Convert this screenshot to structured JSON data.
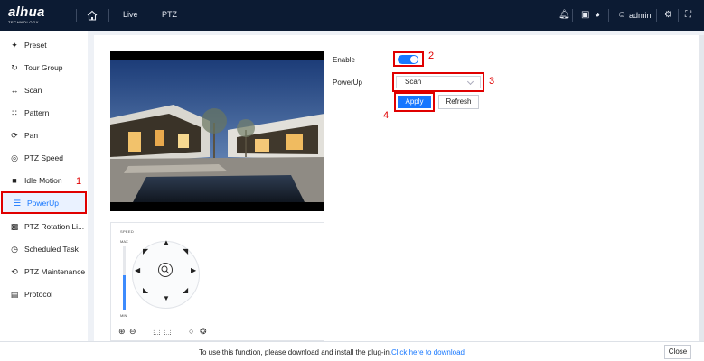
{
  "header": {
    "logo_main": "alhua",
    "logo_sub": "TECHNOLOGY",
    "tabs": [
      {
        "label": "Live"
      },
      {
        "label": "PTZ"
      }
    ],
    "user": "admin",
    "icons": [
      "home-icon",
      "bell-icon",
      "shirt-icon",
      "help-icon",
      "user-icon",
      "settings-icon",
      "fullscreen-icon"
    ]
  },
  "sidebar": {
    "items": [
      {
        "label": "Preset",
        "icon": "preset-icon"
      },
      {
        "label": "Tour Group",
        "icon": "tour-group-icon"
      },
      {
        "label": "Scan",
        "icon": "scan-icon"
      },
      {
        "label": "Pattern",
        "icon": "pattern-icon"
      },
      {
        "label": "Pan",
        "icon": "pan-icon"
      },
      {
        "label": "PTZ Speed",
        "icon": "speed-icon"
      },
      {
        "label": "Idle Motion",
        "icon": "idle-motion-icon"
      },
      {
        "label": "PowerUp",
        "icon": "powerup-icon",
        "active": true
      },
      {
        "label": "PTZ Rotation Li...",
        "icon": "rotation-limit-icon"
      },
      {
        "label": "Scheduled Task",
        "icon": "scheduled-task-icon"
      },
      {
        "label": "PTZ Maintenance",
        "icon": "maintenance-icon"
      },
      {
        "label": "Protocol",
        "icon": "protocol-icon"
      }
    ]
  },
  "form": {
    "enable_label": "Enable",
    "enable_value": true,
    "powerup_label": "PowerUp",
    "powerup_value": "Scan",
    "apply_label": "Apply",
    "refresh_label": "Refresh"
  },
  "annotations": {
    "step1": "1",
    "step2": "2",
    "step3": "3",
    "step4": "4",
    "color": "#e00000"
  },
  "ptz": {
    "speed_label": "SPEED",
    "max_label": "MAX",
    "min_label": "MIN",
    "speed_level_fraction": 0.55
  },
  "plugin_bar": {
    "message": "To use this function, please download and install the plug-in.",
    "link": "Click here to download",
    "close_label": "Close"
  },
  "colors": {
    "accent": "#1677ff",
    "topbar": "#0c1b33",
    "highlight_border": "#e00000"
  }
}
